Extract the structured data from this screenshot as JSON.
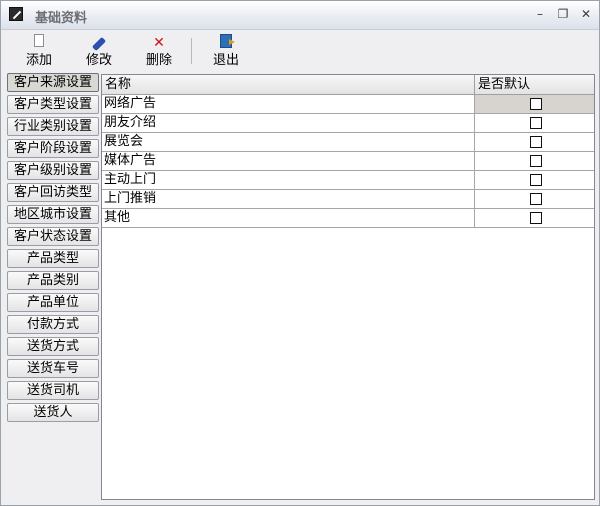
{
  "window": {
    "title": "基础资料",
    "controls": {
      "minimize": "–",
      "restore": "❐",
      "close": "✕"
    }
  },
  "toolbar": {
    "add": {
      "label": "添加",
      "icon": "new-document-icon"
    },
    "edit": {
      "label": "修改",
      "icon": "pencil-icon"
    },
    "delete": {
      "label": "删除",
      "icon": "red-x-icon"
    },
    "exit": {
      "label": "退出",
      "icon": "exit-door-icon"
    }
  },
  "nav": {
    "items": [
      {
        "label": "客户来源设置",
        "active": true
      },
      {
        "label": "客户类型设置"
      },
      {
        "label": "行业类别设置"
      },
      {
        "label": "客户阶段设置"
      },
      {
        "label": "客户级别设置"
      },
      {
        "label": "客户回访类型"
      },
      {
        "label": "地区城市设置"
      },
      {
        "label": "客户状态设置"
      },
      {
        "label": "产品类型"
      },
      {
        "label": "产品类别"
      },
      {
        "label": "产品单位"
      },
      {
        "label": "付款方式"
      },
      {
        "label": "送货方式"
      },
      {
        "label": "送货车号"
      },
      {
        "label": "送货司机"
      },
      {
        "label": "送货人"
      }
    ]
  },
  "grid": {
    "columns": {
      "name": "名称",
      "default": "是否默认"
    },
    "rows": [
      {
        "name": "网络广告",
        "default": false,
        "selected": true
      },
      {
        "name": "朋友介绍",
        "default": false
      },
      {
        "name": "展览会",
        "default": false
      },
      {
        "name": "媒体广告",
        "default": false
      },
      {
        "name": "主动上门",
        "default": false
      },
      {
        "name": "上门推销",
        "default": false
      },
      {
        "name": "其他",
        "default": false
      }
    ]
  }
}
